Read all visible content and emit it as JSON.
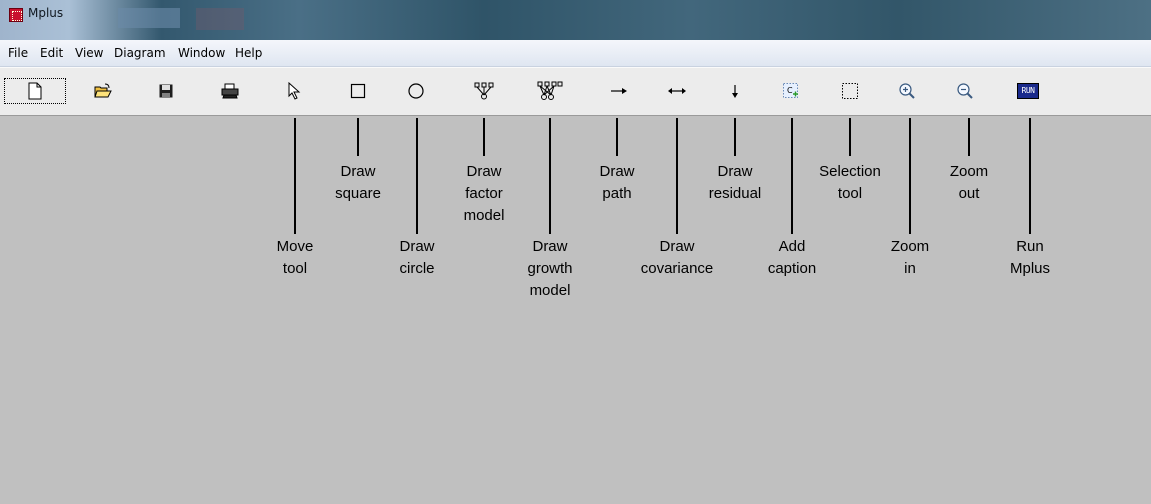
{
  "window": {
    "title": "Mplus"
  },
  "menu": [
    "File",
    "Edit",
    "View",
    "Diagram",
    "Window",
    "Help"
  ],
  "toolbar": {
    "buttons": [
      {
        "name": "new",
        "icon": "new-document-icon"
      },
      {
        "name": "open",
        "icon": "open-folder-icon"
      },
      {
        "name": "save",
        "icon": "save-disk-icon"
      },
      {
        "name": "print",
        "icon": "printer-icon"
      },
      {
        "name": "move",
        "icon": "cursor-arrow-icon"
      },
      {
        "name": "square",
        "icon": "square-icon"
      },
      {
        "name": "circle",
        "icon": "circle-icon"
      },
      {
        "name": "factor-model",
        "icon": "factor-model-icon"
      },
      {
        "name": "growth-model",
        "icon": "growth-model-icon"
      },
      {
        "name": "path",
        "icon": "arrow-right-icon"
      },
      {
        "name": "covariance",
        "icon": "double-arrow-icon"
      },
      {
        "name": "residual",
        "icon": "arrow-down-icon"
      },
      {
        "name": "caption",
        "icon": "caption-icon"
      },
      {
        "name": "selection",
        "icon": "selection-rect-icon"
      },
      {
        "name": "zoom-in",
        "icon": "zoom-in-icon"
      },
      {
        "name": "zoom-out",
        "icon": "zoom-out-icon"
      },
      {
        "name": "run",
        "icon": "run-icon",
        "text": "RUN"
      }
    ]
  },
  "callouts": [
    {
      "name": "move",
      "label": "Move\ntool"
    },
    {
      "name": "square",
      "label": "Draw\nsquare"
    },
    {
      "name": "circle",
      "label": "Draw\ncircle"
    },
    {
      "name": "factor-model",
      "label": "Draw\nfactor\nmodel"
    },
    {
      "name": "growth-model",
      "label": "Draw\ngrowth\nmodel"
    },
    {
      "name": "path",
      "label": "Draw\npath"
    },
    {
      "name": "covariance",
      "label": "Draw\ncovariance"
    },
    {
      "name": "residual",
      "label": "Draw\nresidual"
    },
    {
      "name": "caption",
      "label": "Add\ncaption"
    },
    {
      "name": "selection",
      "label": "Selection\ntool"
    },
    {
      "name": "zoom-in",
      "label": "Zoom\nin"
    },
    {
      "name": "zoom-out",
      "label": "Zoom\nout"
    },
    {
      "name": "run",
      "label": "Run\nMplus"
    }
  ],
  "colors": {
    "workspace": "#c0c0c0",
    "toolbar": "#ececec",
    "menubar": "#e8edf5",
    "run_button": "#1a2a8c"
  }
}
